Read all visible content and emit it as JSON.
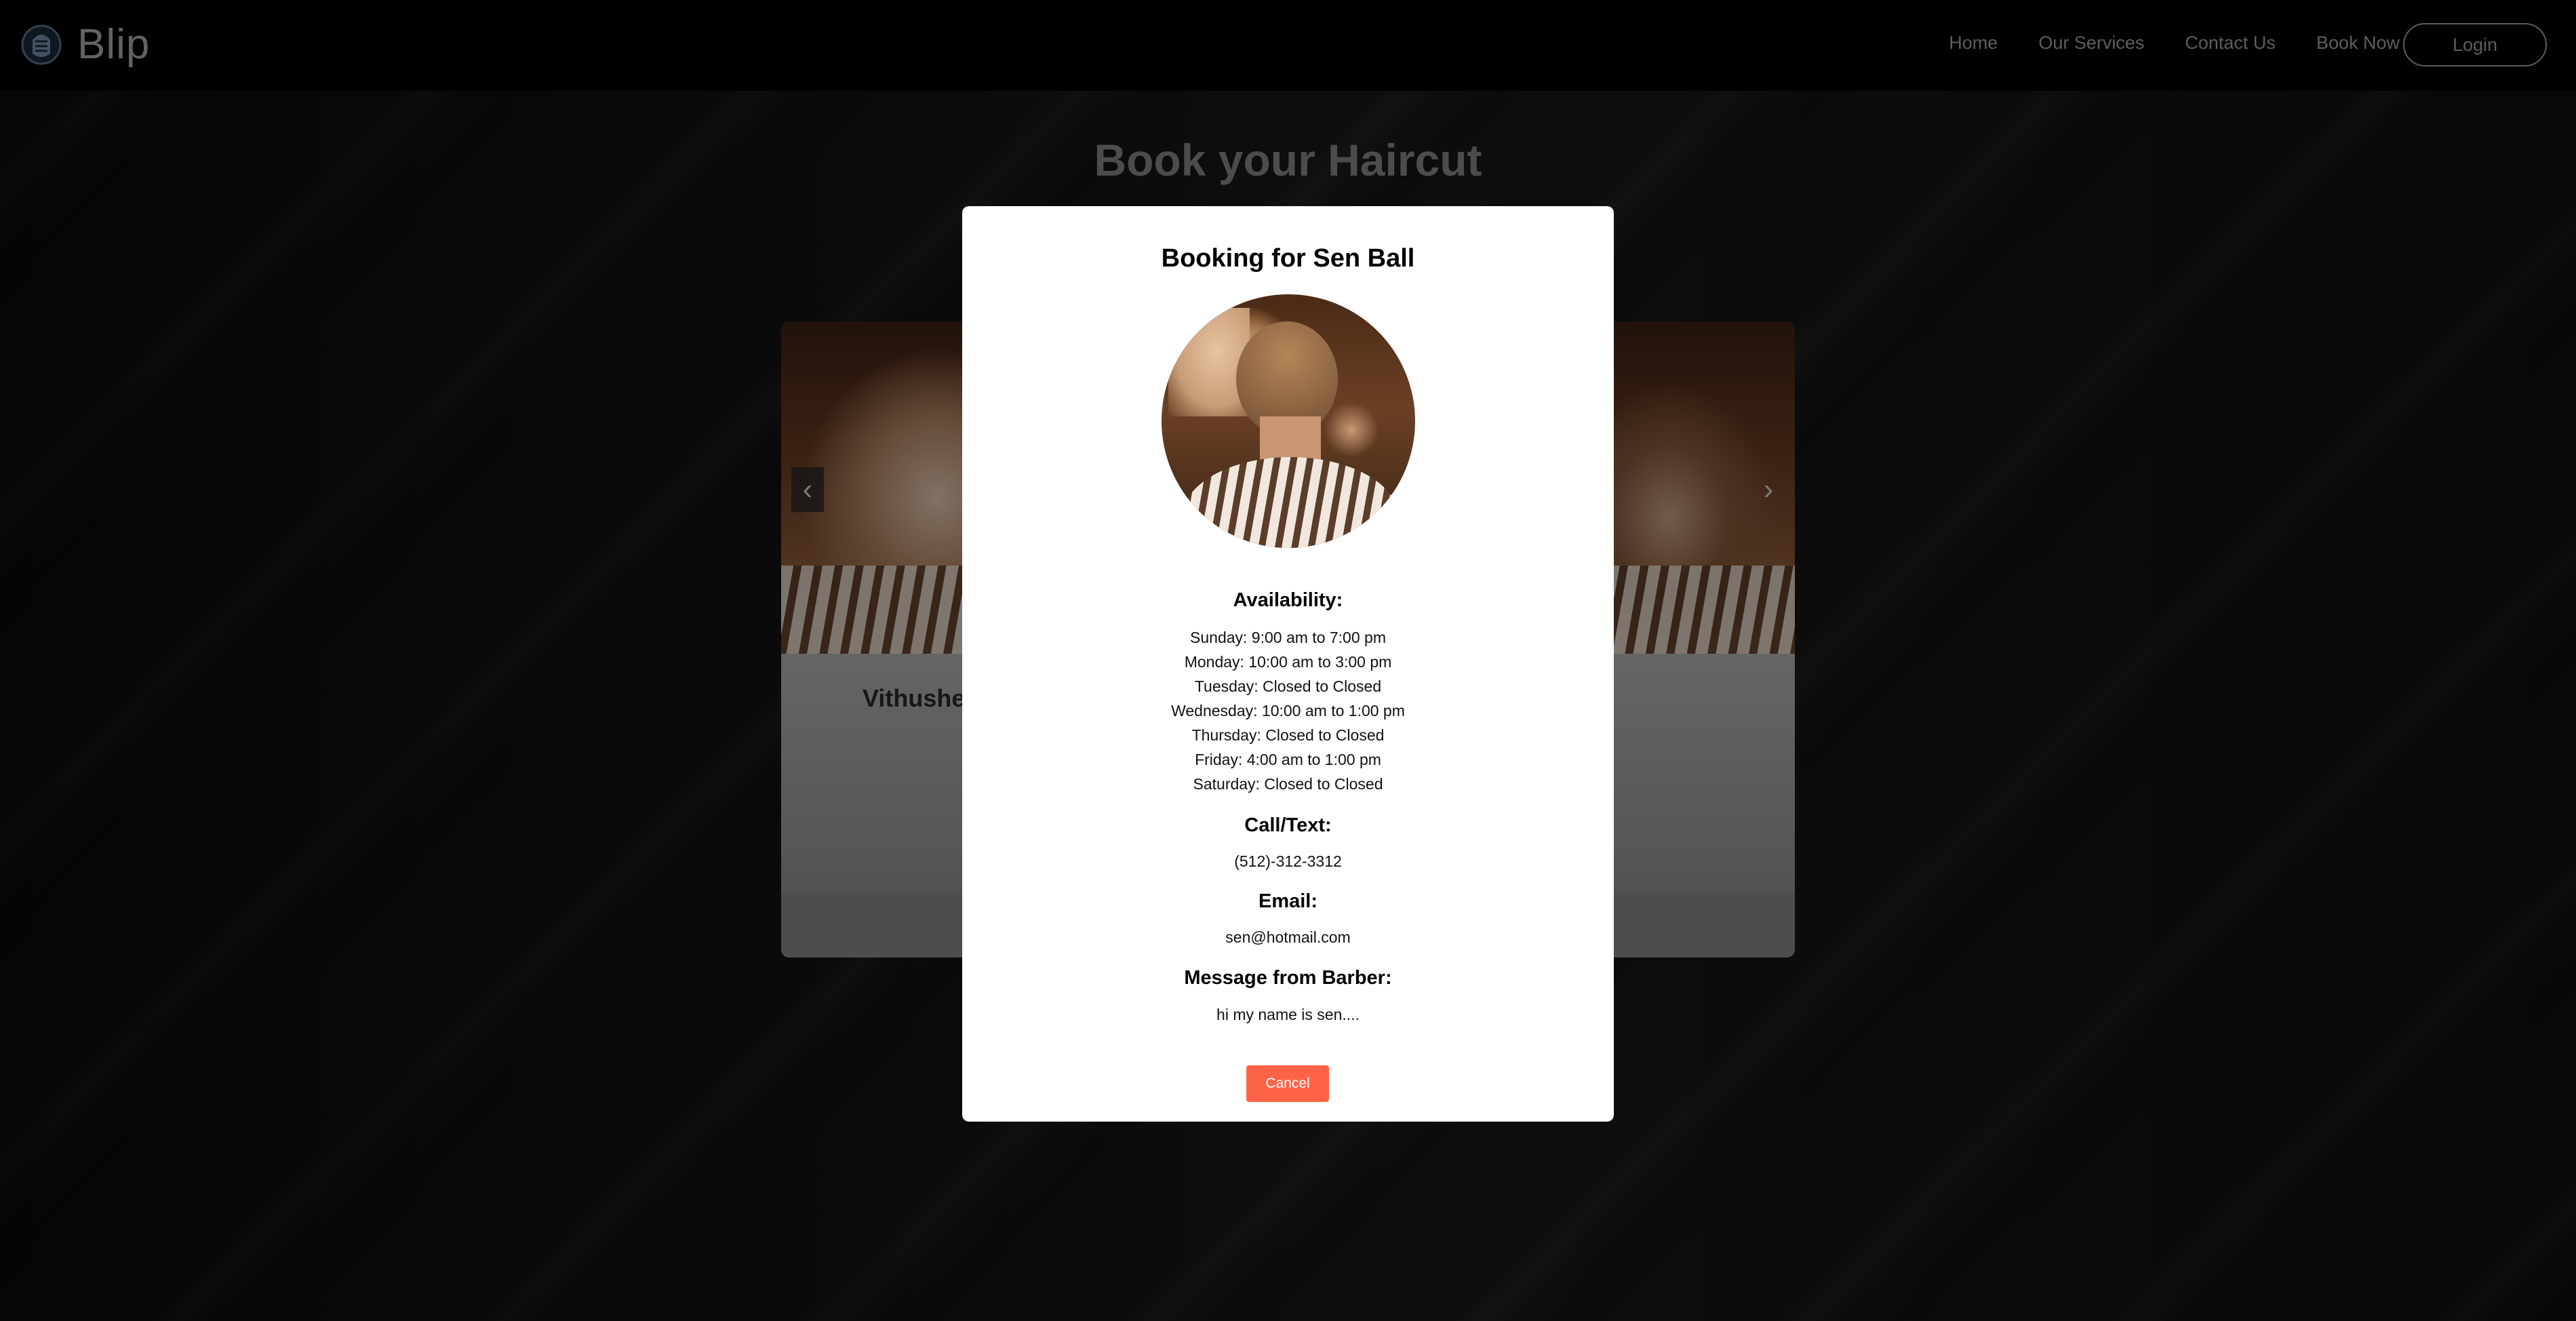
{
  "brand": {
    "name": "Blip",
    "logo_icon": "fist-logo-icon"
  },
  "nav": {
    "links": [
      "Home",
      "Our Services",
      "Contact Us",
      "Book Now"
    ],
    "login_label": "Login"
  },
  "page": {
    "title": "Book your Haircut"
  },
  "carousel": {
    "barber_name": "Vithushe",
    "prev_icon": "chevron-left-icon",
    "next_icon": "chevron-right-icon",
    "prev_glyph": "‹",
    "next_glyph": "›"
  },
  "modal": {
    "title": "Booking for Sen Ball",
    "availability_heading": "Availability:",
    "availability": [
      "Sunday: 9:00 am to 7:00 pm",
      "Monday: 10:00 am to 3:00 pm",
      "Tuesday: Closed to Closed",
      "Wednesday: 10:00 am to 1:00 pm",
      "Thursday: Closed to Closed",
      "Friday: 4:00 am to 1:00 pm",
      "Saturday: Closed to Closed"
    ],
    "call_heading": "Call/Text:",
    "phone": "(512)-312-3312",
    "email_heading": "Email:",
    "email": "sen@hotmail.com",
    "message_heading": "Message from Barber:",
    "message": "hi my name is sen....",
    "cancel_label": "Cancel"
  },
  "colors": {
    "accent_cancel": "#ff6347",
    "nav_bg": "#000000",
    "nav_text": "#a9a9a9"
  }
}
